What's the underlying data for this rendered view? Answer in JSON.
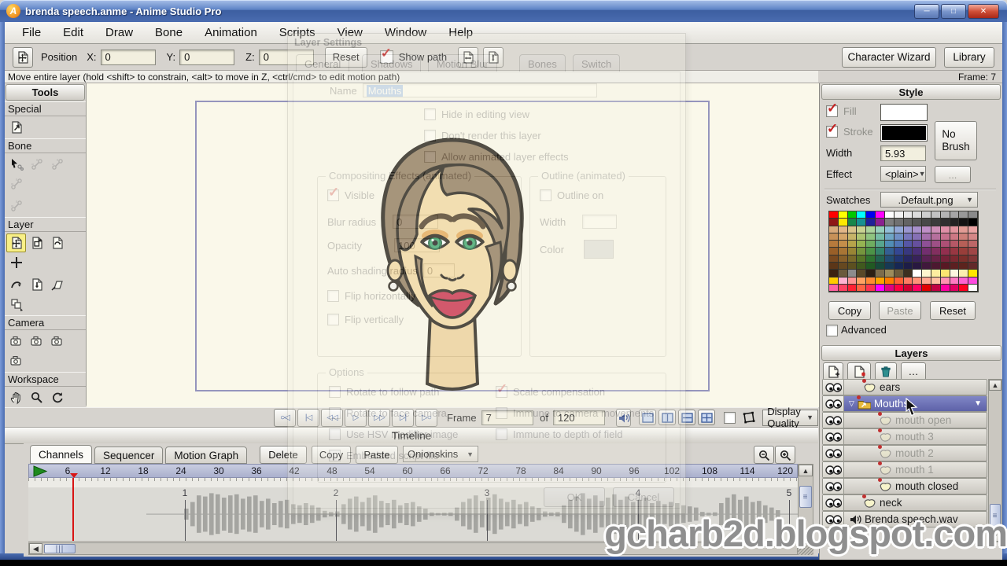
{
  "window": {
    "title": "brenda speech.anme - Anime Studio Pro",
    "minimize": "─",
    "maximize": "□",
    "close": "✕",
    "app_letter": "A"
  },
  "menu_bar": {
    "items": [
      "File",
      "Edit",
      "Draw",
      "Bone",
      "Animation",
      "Scripts",
      "View",
      "Window",
      "Help"
    ]
  },
  "toolbar": {
    "position_label": "Position",
    "x_label": "X:",
    "x_value": "0",
    "y_label": "Y:",
    "y_value": "0",
    "z_label": "Z:",
    "z_value": "0",
    "reset_label": "Reset",
    "show_path_label": "Show path",
    "character_wizard_label": "Character Wizard",
    "library_label": "Library"
  },
  "status_bar": {
    "message": "Move entire layer (hold <shift> to constrain, <alt> to move in Z, <ctrl/cmd> to edit motion path)",
    "frame_indicator": "Frame: 7"
  },
  "tools_panel": {
    "title": "Tools",
    "sections": [
      {
        "label": "Special",
        "rows": [
          [
            {
              "icon": "rotate-layer-icon",
              "state": "normal"
            }
          ]
        ]
      },
      {
        "label": "Bone",
        "rows": [
          [
            {
              "icon": "select-bone-icon",
              "state": "normal"
            },
            {
              "icon": "translate-bone-icon",
              "state": "disabled"
            },
            {
              "icon": "scale-bone-icon",
              "state": "disabled"
            },
            {
              "icon": "rotate-bone-icon",
              "state": "disabled"
            }
          ],
          [
            {
              "icon": "bone-strength-icon",
              "state": "disabled"
            }
          ]
        ]
      },
      {
        "label": "Layer",
        "rows": [
          [
            {
              "icon": "translate-layer-icon",
              "state": "active"
            },
            {
              "icon": "scale-layer-icon",
              "state": "normal"
            },
            {
              "icon": "rotate-layer-z-icon",
              "state": "normal"
            },
            {
              "icon": "set-origin-icon",
              "state": "normal"
            }
          ],
          [
            {
              "icon": "follow-path-icon",
              "state": "normal"
            },
            {
              "icon": "rotate-layer-y-icon",
              "state": "normal"
            },
            {
              "icon": "shear-layer-icon",
              "state": "normal"
            },
            {
              "icon": "depth-sort-icon",
              "state": "normal"
            }
          ]
        ]
      },
      {
        "label": "Camera",
        "rows": [
          [
            {
              "icon": "track-camera-icon",
              "state": "normal"
            },
            {
              "icon": "zoom-camera-icon",
              "state": "normal"
            },
            {
              "icon": "roll-camera-icon",
              "state": "normal"
            },
            {
              "icon": "pan-tilt-camera-icon",
              "state": "normal"
            }
          ]
        ]
      },
      {
        "label": "Workspace",
        "rows": [
          [
            {
              "icon": "pan-icon",
              "state": "normal"
            },
            {
              "icon": "magnify-icon",
              "state": "normal"
            },
            {
              "icon": "rotate-view-icon",
              "state": "normal"
            },
            {
              "icon": "orbit-view-icon",
              "state": "normal"
            }
          ]
        ]
      }
    ]
  },
  "dialog": {
    "title": "Layer Settings",
    "tabs": [
      "General",
      "Shadows",
      "Motion Blur",
      "Bones",
      "Switch"
    ],
    "active_tab": "General",
    "name_label": "Name",
    "name_value": "Mouths",
    "checkboxes": [
      "Hide in editing view",
      "Don't render this layer",
      "Allow animated layer effects"
    ],
    "compositing": {
      "legend": "Compositing Effects (animated)",
      "visible_label": "Visible",
      "blur_label": "Blur radius",
      "blur_value": "0",
      "opacity_label": "Opacity",
      "opacity_value": "100",
      "auto_label": "Auto shading radius",
      "auto_value": "0",
      "flip_h_label": "Flip horizontally",
      "flip_v_label": "Flip vertically"
    },
    "outline": {
      "legend": "Outline (animated)",
      "on_label": "Outline on",
      "width_label": "Width",
      "color_label": "Color"
    },
    "options": {
      "legend": "Options",
      "col1": [
        "Rotate to follow path",
        "Rotate to face camera",
        "Use HSV modifier image",
        "Embedded script file"
      ],
      "col2": [
        "Scale compensation",
        "Immune to camera movements",
        "Immune to depth of field"
      ],
      "checked": "Scale compensation"
    },
    "ok_label": "OK",
    "cancel_label": "Cancel"
  },
  "playback_bar": {
    "transport": [
      {
        "name": "rewind-button",
        "glyph": "○◁"
      },
      {
        "name": "start-button",
        "glyph": "|◁"
      },
      {
        "name": "step-back-button",
        "glyph": "◁◁"
      },
      {
        "name": "play-button",
        "glyph": "▷"
      },
      {
        "name": "step-forward-button",
        "glyph": "▷▷"
      },
      {
        "name": "end-button",
        "glyph": "▷|"
      },
      {
        "name": "loop-button",
        "glyph": "▷○"
      }
    ],
    "frame_label": "Frame",
    "frame_value": "7",
    "of_label": "of",
    "total_value": "120",
    "display_quality_label": "Display Quality"
  },
  "timeline_panel": {
    "title": "Timeline",
    "tabs": [
      "Channels",
      "Sequencer",
      "Motion Graph"
    ],
    "active_tab": "Channels",
    "delete_label": "Delete",
    "copy_label": "Copy",
    "paste_label": "Paste",
    "onionskins_label": "Onionskins",
    "ruler_numbers": [
      6,
      12,
      18,
      24,
      30,
      36,
      42,
      48,
      54,
      60,
      66,
      72,
      78,
      84,
      90,
      96,
      102,
      108,
      114,
      120
    ],
    "current_frame": 7,
    "second_markers": [
      "1",
      "2",
      "3",
      "4",
      "5"
    ],
    "waveform": [
      0,
      0,
      0,
      0,
      0,
      0,
      0,
      0,
      0,
      0.25,
      0.55,
      0.85,
      0.8,
      0.95,
      0.9,
      0.75,
      0.85,
      0.9,
      0.7,
      0.8,
      0.85,
      0.6,
      0.7,
      0.5,
      0.6,
      0.65,
      0.45,
      0.4,
      0.5,
      0.4,
      0.3,
      0.15,
      0.1,
      0.12,
      0.45,
      0.7,
      0.8,
      0.55,
      0.75,
      0.85,
      0.6,
      0.5,
      0.65,
      0.4,
      0.5,
      0.55,
      0.35,
      0.25,
      0.08,
      0.05,
      0.06,
      0.08,
      0.3,
      0.55,
      0.7,
      0.85,
      0.6,
      0.75,
      0.9,
      0.7,
      0.55,
      0.65,
      0.45,
      0.55,
      0.35,
      0.28,
      0.12,
      0.08,
      0.1,
      0.4,
      0.65,
      0.8,
      0.95,
      0.7,
      0.85,
      0.6,
      0.75,
      0.9,
      0.65,
      0.8,
      0.55,
      0.65,
      0.75,
      0.5,
      0.6,
      0.45,
      0.55,
      0.5,
      0.4,
      0.35,
      0.3,
      0.1,
      0.06,
      0.08,
      0.5,
      0.75,
      0.9,
      0.65,
      0.8,
      0.55,
      0.6,
      0.4,
      0.3,
      0.18
    ]
  },
  "style_panel": {
    "title": "Style",
    "fill_label": "Fill",
    "fill_color": "#ffffff",
    "stroke_label": "Stroke",
    "stroke_color": "#000000",
    "width_label": "Width",
    "width_value": "5.93",
    "no_brush_label": "No Brush",
    "effect_label": "Effect",
    "effect_value": "<plain>",
    "more_label": "...",
    "swatches_label": "Swatches",
    "swatches_value": ".Default.png",
    "copy_label": "Copy",
    "paste_label": "Paste",
    "reset_label": "Reset",
    "advanced_label": "Advanced",
    "palette": [
      [
        "#ff0000",
        "#ffff00",
        "#00c800",
        "#00ffff",
        "#0000f0",
        "#ff00ff",
        "#ffffff",
        "#f4f4f4",
        "#e8e8e8",
        "#dcdcdc",
        "#cfcfcf",
        "#c2c2c2",
        "#b4b4b4",
        "#a6a6a6",
        "#989898",
        "#8a8a8a"
      ],
      [
        "#8e1515",
        "#ffe800",
        "#18864a",
        "#189090",
        "#202098",
        "#8a2090",
        "#7d7d7d",
        "#707070",
        "#636363",
        "#565656",
        "#494949",
        "#3c3c3c",
        "#2f2f2f",
        "#222222",
        "#131313",
        "#000000"
      ],
      [
        "#d8a97a",
        "#e2b688",
        "#d9c48b",
        "#c9d392",
        "#abd39c",
        "#97cfbd",
        "#92bed7",
        "#93a8d7",
        "#9a97d0",
        "#a890cb",
        "#bf8fc7",
        "#cf8fb7",
        "#df8fa7",
        "#e2959e",
        "#e29c95",
        "#eba4a4"
      ],
      [
        "#c89158",
        "#d4a468",
        "#c6b468",
        "#adc471",
        "#8fc480",
        "#76bda6",
        "#6fa6c6",
        "#7090c6",
        "#7777bd",
        "#8670b5",
        "#a670ad",
        "#b6709d",
        "#c6708d",
        "#cd7884",
        "#cd7f78",
        "#d58787"
      ],
      [
        "#b77a3c",
        "#c48e4a",
        "#b6a44a",
        "#96b452",
        "#6fad60",
        "#57a58e",
        "#518db6",
        "#5176b6",
        "#5656a6",
        "#66509e",
        "#8e5096",
        "#9e5086",
        "#ae5076",
        "#b65866",
        "#b65f57",
        "#be6767"
      ],
      [
        "#995f28",
        "#a87535",
        "#998535",
        "#75953d",
        "#4c9347",
        "#34836b",
        "#345f93",
        "#344793",
        "#38387f",
        "#4a2f77",
        "#722f6f",
        "#822f5f",
        "#922f4f",
        "#983742",
        "#983e3a",
        "#a04646"
      ],
      [
        "#7a4a20",
        "#88602a",
        "#7a6a2a",
        "#587527",
        "#2f7330",
        "#226350",
        "#224c73",
        "#223673",
        "#272763",
        "#38225b",
        "#5a2255",
        "#682247",
        "#762239",
        "#7c2931",
        "#7c2f2b",
        "#823636"
      ],
      [
        "#5c3618",
        "#664820",
        "#5c5020",
        "#40591e",
        "#215923",
        "#17493a",
        "#173954",
        "#172754",
        "#1d1d47",
        "#281840",
        "#40183c",
        "#4c1830",
        "#581824",
        "#5c1f21",
        "#5c231e",
        "#622929"
      ],
      [
        "#3c2210",
        "#6a5a3c",
        "#8c8c8c",
        "#594828",
        "#2c2014",
        "#7c6c4c",
        "#9c8c5c",
        "#6c5c3c",
        "#3c2f20",
        "#ffffff",
        "#fdf6cf",
        "#fceea0",
        "#fbe570",
        "#fdf6df",
        "#fceeb0",
        "#ffe600"
      ],
      [
        "#ffcc00",
        "#ffb3d1",
        "#ff9494",
        "#ffa263",
        "#ff8a33",
        "#ffa200",
        "#ff7b00",
        "#ff6233",
        "#ff7b63",
        "#ff9279",
        "#ffa992",
        "#ffc1a2",
        "#ff92b1",
        "#ff7bc1",
        "#ff63d1",
        "#ff4be0"
      ],
      [
        "#ff63a2",
        "#ff4263",
        "#ff2133",
        "#ff6342",
        "#ff3152",
        "#ff00ff",
        "#e20081",
        "#ff0042",
        "#d20031",
        "#ff0063",
        "#e20000",
        "#c20042",
        "#ff00a2",
        "#e20063",
        "#ff0021",
        "#ffffff"
      ]
    ]
  },
  "layers_panel": {
    "title": "Layers",
    "rows": [
      {
        "label": "ears",
        "type": "vector",
        "indent": 1,
        "red_dot": true,
        "dimmed": false,
        "selected": false
      },
      {
        "label": "Mouths",
        "type": "group",
        "indent": 0,
        "red_dot": true,
        "dimmed": false,
        "selected": true,
        "expanded": true
      },
      {
        "label": "mouth open",
        "type": "vector",
        "indent": 2,
        "red_dot": true,
        "dimmed": true,
        "selected": false
      },
      {
        "label": "mouth 3",
        "type": "vector",
        "indent": 2,
        "red_dot": true,
        "dimmed": true,
        "selected": false
      },
      {
        "label": "mouth 2",
        "type": "vector",
        "indent": 2,
        "red_dot": true,
        "dimmed": true,
        "selected": false
      },
      {
        "label": "mouth 1",
        "type": "vector",
        "indent": 2,
        "red_dot": true,
        "dimmed": true,
        "selected": false
      },
      {
        "label": "mouth closed",
        "type": "vector",
        "indent": 2,
        "red_dot": true,
        "dimmed": false,
        "selected": false
      },
      {
        "label": "neck",
        "type": "vector",
        "indent": 1,
        "red_dot": true,
        "dimmed": false,
        "selected": false
      },
      {
        "label": "Brenda speech.wav",
        "type": "audio",
        "indent": 0,
        "red_dot": false,
        "dimmed": false,
        "selected": false
      }
    ]
  },
  "watermark": {
    "text": "gcharb2d.blogspot.com"
  },
  "colors": {
    "selection_row": "#6d72b8",
    "playhead": "#d81414",
    "check_accent": "#c32222",
    "canvas_bg": "#faf8ea",
    "ruler_bg": "#aab0cd"
  }
}
